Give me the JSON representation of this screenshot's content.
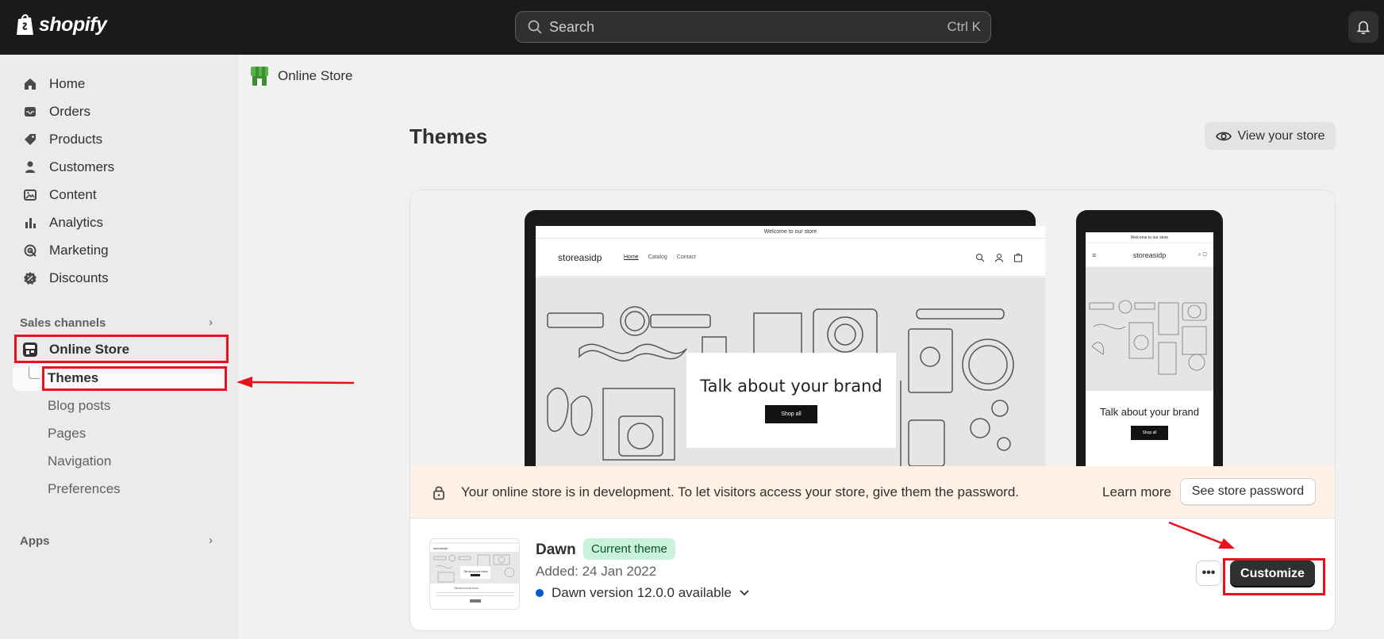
{
  "topbar": {
    "logo_text": "shopify",
    "search_placeholder": "Search",
    "search_shortcut": "Ctrl K"
  },
  "sidebar": {
    "items": [
      {
        "label": "Home",
        "icon": "home-icon"
      },
      {
        "label": "Orders",
        "icon": "inbox-icon"
      },
      {
        "label": "Products",
        "icon": "tag-icon"
      },
      {
        "label": "Customers",
        "icon": "person-icon"
      },
      {
        "label": "Content",
        "icon": "image-icon"
      },
      {
        "label": "Analytics",
        "icon": "bar-chart-icon"
      },
      {
        "label": "Marketing",
        "icon": "target-icon"
      },
      {
        "label": "Discounts",
        "icon": "discount-icon"
      }
    ],
    "sales_channels_title": "Sales channels",
    "online_store_label": "Online Store",
    "sub_items": [
      "Themes",
      "Blog posts",
      "Pages",
      "Navigation",
      "Preferences"
    ],
    "apps_title": "Apps"
  },
  "breadcrumb": {
    "label": "Online Store"
  },
  "main": {
    "title": "Themes",
    "view_store_label": "View your store"
  },
  "preview": {
    "announcement": "Welcome to our store",
    "store_name": "storeasidp",
    "nav_links": [
      "Home",
      "Catalog",
      "Contact"
    ],
    "hero_title": "Talk about your brand",
    "hero_button": "Shop all",
    "phone_title": "Talk about your brand",
    "phone_button": "Shop all"
  },
  "banner": {
    "text": "Your online store is in development. To let visitors access your store, give them the password.",
    "learn_more": "Learn more",
    "password_button": "See store password"
  },
  "theme": {
    "name": "Dawn",
    "badge": "Current theme",
    "added": "Added: 24 Jan 2022",
    "version": "Dawn version 12.0.0 available",
    "more_label": "•••",
    "customize_label": "Customize"
  },
  "colors": {
    "topbar": "#1a1a1a",
    "highlight": "#e8121f",
    "badge_bg": "#c9f2dc",
    "banner_bg": "#fff1e3",
    "version_dot": "#005bd3"
  }
}
